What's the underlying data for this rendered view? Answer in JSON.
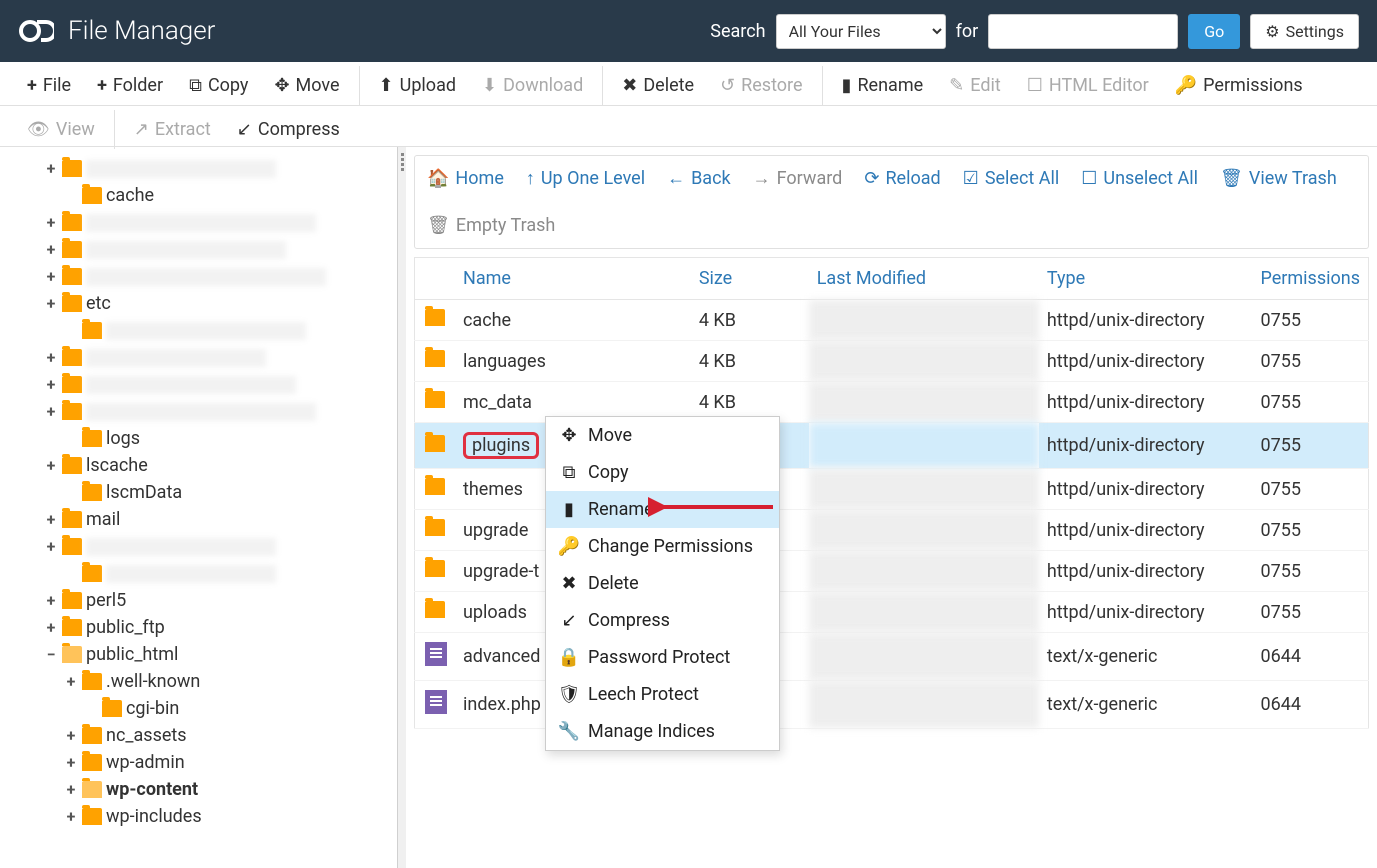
{
  "header": {
    "title": "File Manager",
    "search_label": "Search",
    "search_select": "All Your Files",
    "for_label": "for",
    "go_label": "Go",
    "settings_label": "Settings"
  },
  "toolbar": {
    "file": "File",
    "folder": "Folder",
    "copy": "Copy",
    "move": "Move",
    "upload": "Upload",
    "download": "Download",
    "delete": "Delete",
    "restore": "Restore",
    "rename": "Rename",
    "edit": "Edit",
    "html_editor": "HTML Editor",
    "permissions": "Permissions",
    "view": "View",
    "extract": "Extract",
    "compress": "Compress"
  },
  "content_toolbar": {
    "home": "Home",
    "up": "Up One Level",
    "back": "Back",
    "forward": "Forward",
    "reload": "Reload",
    "select_all": "Select All",
    "unselect_all": "Unselect All",
    "view_trash": "View Trash",
    "empty_trash": "Empty Trash"
  },
  "table": {
    "headers": {
      "name": "Name",
      "size": "Size",
      "last_modified": "Last Modified",
      "type": "Type",
      "permissions": "Permissions"
    },
    "rows": [
      {
        "icon": "folder",
        "name": "cache",
        "size": "4 KB",
        "modified": "",
        "type": "httpd/unix-directory",
        "perms": "0755",
        "selected": false
      },
      {
        "icon": "folder",
        "name": "languages",
        "size": "4 KB",
        "modified": "",
        "type": "httpd/unix-directory",
        "perms": "0755",
        "selected": false
      },
      {
        "icon": "folder",
        "name": "mc_data",
        "size": "4 KB",
        "modified": "",
        "type": "httpd/unix-directory",
        "perms": "0755",
        "selected": false
      },
      {
        "icon": "folder",
        "name": "plugins",
        "size": "",
        "modified": "",
        "type": "httpd/unix-directory",
        "perms": "0755",
        "selected": true,
        "highlight": true
      },
      {
        "icon": "folder",
        "name": "themes",
        "size": "",
        "modified": "",
        "type": "httpd/unix-directory",
        "perms": "0755",
        "selected": false
      },
      {
        "icon": "folder",
        "name": "upgrade",
        "size": "",
        "modified": "",
        "type": "httpd/unix-directory",
        "perms": "0755",
        "selected": false
      },
      {
        "icon": "folder",
        "name": "upgrade-t",
        "size": "",
        "modified": "",
        "type": "httpd/unix-directory",
        "perms": "0755",
        "selected": false
      },
      {
        "icon": "folder",
        "name": "uploads",
        "size": "",
        "modified": "",
        "type": "httpd/unix-directory",
        "perms": "0755",
        "selected": false
      },
      {
        "icon": "file",
        "name": "advanced",
        "size": "",
        "modified": "",
        "type": "text/x-generic",
        "perms": "0644",
        "selected": false
      },
      {
        "icon": "file",
        "name": "index.php",
        "size": "",
        "modified": "",
        "type": "text/x-generic",
        "perms": "0644",
        "selected": false
      }
    ]
  },
  "tree": [
    {
      "indent": 0,
      "toggle": "+",
      "label": "",
      "blur": true,
      "blurw": 190
    },
    {
      "indent": 1,
      "toggle": "",
      "label": "cache"
    },
    {
      "indent": 0,
      "toggle": "+",
      "label": "",
      "blur": true,
      "blurw": 230
    },
    {
      "indent": 0,
      "toggle": "+",
      "label": "",
      "blur": true,
      "blurw": 200
    },
    {
      "indent": 0,
      "toggle": "+",
      "label": "",
      "blur": true,
      "blurw": 240
    },
    {
      "indent": 0,
      "toggle": "+",
      "label": "etc"
    },
    {
      "indent": 1,
      "toggle": "",
      "label": "",
      "blur": true,
      "blurw": 200
    },
    {
      "indent": 0,
      "toggle": "+",
      "label": "",
      "blur": true,
      "blurw": 180
    },
    {
      "indent": 0,
      "toggle": "+",
      "label": "",
      "blur": true,
      "blurw": 210
    },
    {
      "indent": 0,
      "toggle": "+",
      "label": "",
      "blur": true,
      "blurw": 230
    },
    {
      "indent": 1,
      "toggle": "",
      "label": "logs"
    },
    {
      "indent": 0,
      "toggle": "+",
      "label": "lscache"
    },
    {
      "indent": 1,
      "toggle": "",
      "label": "lscmData"
    },
    {
      "indent": 0,
      "toggle": "+",
      "label": "mail"
    },
    {
      "indent": 0,
      "toggle": "+",
      "label": "",
      "blur": true,
      "blurw": 190
    },
    {
      "indent": 1,
      "toggle": "",
      "label": "",
      "blur": true,
      "blurw": 170
    },
    {
      "indent": 0,
      "toggle": "+",
      "label": "perl5"
    },
    {
      "indent": 0,
      "toggle": "+",
      "label": "public_ftp"
    },
    {
      "indent": 0,
      "toggle": "−",
      "label": "public_html",
      "open": true
    },
    {
      "indent": 1,
      "toggle": "+",
      "label": ".well-known"
    },
    {
      "indent": 2,
      "toggle": "",
      "label": "cgi-bin"
    },
    {
      "indent": 1,
      "toggle": "+",
      "label": "nc_assets"
    },
    {
      "indent": 1,
      "toggle": "+",
      "label": "wp-admin"
    },
    {
      "indent": 1,
      "toggle": "+",
      "label": "wp-content",
      "bold": true,
      "open": true
    },
    {
      "indent": 1,
      "toggle": "+",
      "label": "wp-includes"
    }
  ],
  "context_menu": [
    {
      "icon": "move",
      "label": "Move"
    },
    {
      "icon": "copy",
      "label": "Copy"
    },
    {
      "icon": "rename",
      "label": "Rename",
      "highlight": true
    },
    {
      "icon": "perms",
      "label": "Change Permissions"
    },
    {
      "icon": "delete",
      "label": "Delete"
    },
    {
      "icon": "compress",
      "label": "Compress"
    },
    {
      "icon": "password",
      "label": "Password Protect"
    },
    {
      "icon": "leech",
      "label": "Leech Protect"
    },
    {
      "icon": "indices",
      "label": "Manage Indices"
    }
  ]
}
